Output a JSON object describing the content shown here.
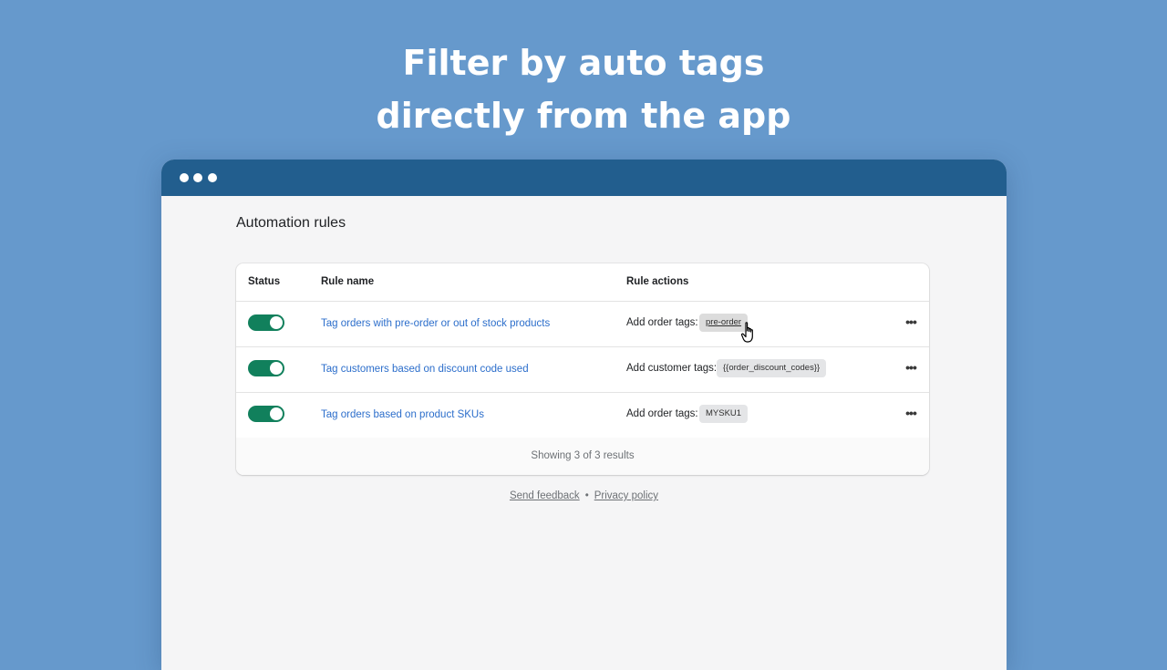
{
  "headline": {
    "line1": "Filter by auto tags",
    "line2": "directly from the app"
  },
  "window": {
    "bar_color": "#225e8e"
  },
  "page": {
    "title": "Automation rules"
  },
  "table": {
    "headers": {
      "status": "Status",
      "rule_name": "Rule name",
      "rule_actions": "Rule actions"
    },
    "rows": [
      {
        "enabled": true,
        "name": "Tag orders with pre-order or out of stock products",
        "action_label": "Add order tags:",
        "tag": "pre-order"
      },
      {
        "enabled": true,
        "name": "Tag customers based on discount code used",
        "action_label": "Add customer tags:",
        "tag": "{{order_discount_codes}}"
      },
      {
        "enabled": true,
        "name": "Tag orders based on product SKUs",
        "action_label": "Add order tags:",
        "tag": "MYSKU1"
      }
    ],
    "footer": "Showing 3 of 3 results"
  },
  "footer": {
    "feedback": "Send feedback",
    "separator": "•",
    "privacy": "Privacy policy"
  },
  "colors": {
    "background": "#6699cc",
    "toggle_on": "#11805c",
    "link": "#2c6ecb"
  },
  "icons": {
    "more": "horizontal-dots-icon",
    "cursor": "hand-pointer-icon"
  }
}
